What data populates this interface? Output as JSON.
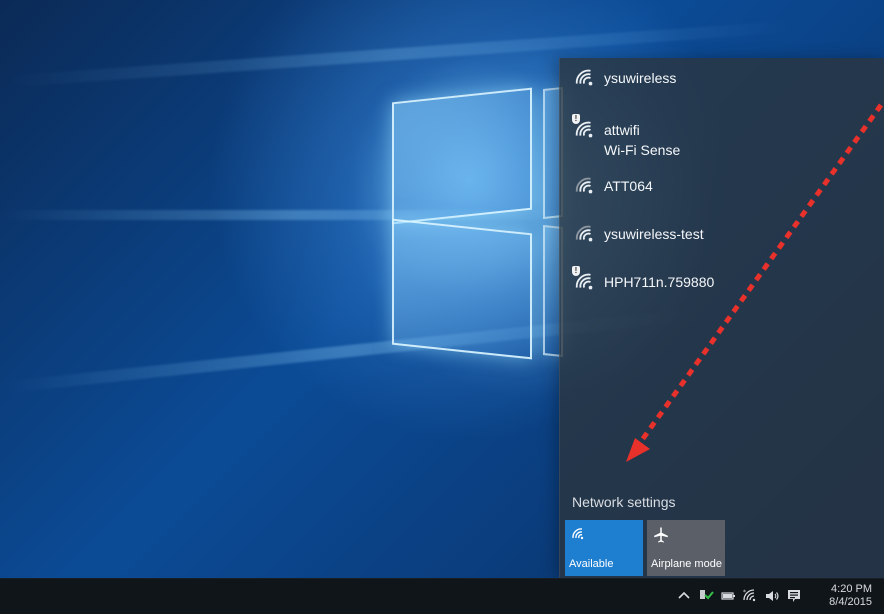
{
  "flyout": {
    "networks": [
      {
        "name": "ysuwireless",
        "secured": false
      },
      {
        "name": "attwifi",
        "sub": "Wi-Fi Sense",
        "secured": true
      },
      {
        "name": "ATT064",
        "secured": false
      },
      {
        "name": "ysuwireless-test",
        "secured": false
      },
      {
        "name": "HPH711n.759880",
        "secured": true
      }
    ],
    "network_settings": "Network settings",
    "tiles": [
      {
        "label": "Available",
        "icon": "wifi-icon",
        "active": true
      },
      {
        "label": "Airplane mode",
        "icon": "airplane-icon",
        "active": false
      }
    ]
  },
  "taskbar": {
    "clock_time": "4:20 PM",
    "clock_date": "8/4/2015"
  },
  "colors": {
    "flyout_bg": "#2c343c",
    "accent": "#1e7fd1",
    "tile_inactive": "#5b6068",
    "arrow": "#e8312a",
    "taskbar": "#101519"
  }
}
